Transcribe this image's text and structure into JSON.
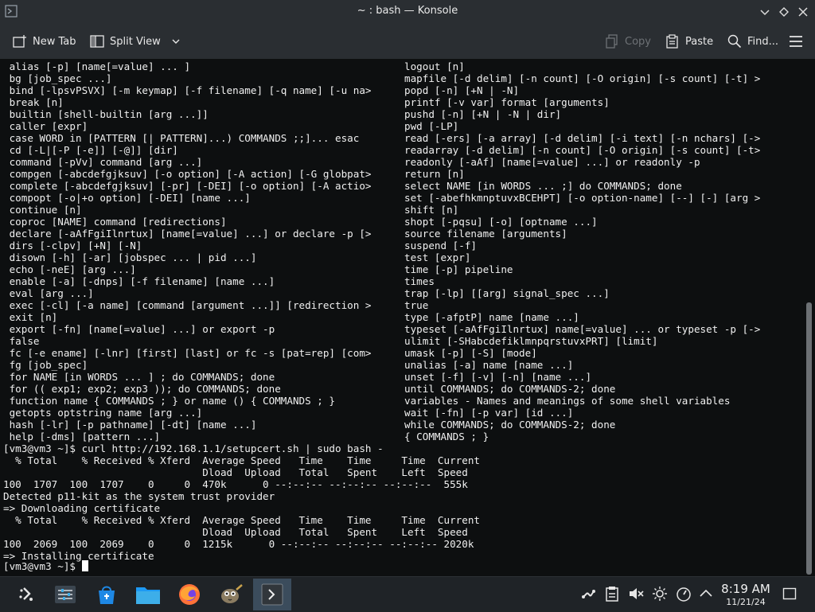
{
  "window": {
    "title": "~ : bash — Konsole"
  },
  "toolbar": {
    "new_tab": "New Tab",
    "split_view": "Split View",
    "copy": "Copy",
    "paste": "Paste",
    "find": "Find..."
  },
  "terminal": {
    "help_left": [
      " alias [-p] [name[=value] ... ]",
      " bg [job_spec ...]",
      " bind [-lpsvPSVX] [-m keymap] [-f filename] [-q name] [-u na>",
      " break [n]",
      " builtin [shell-builtin [arg ...]]",
      " caller [expr]",
      " case WORD in [PATTERN [| PATTERN]...) COMMANDS ;;]... esac",
      " cd [-L|[-P [-e]] [-@]] [dir]",
      " command [-pVv] command [arg ...]",
      " compgen [-abcdefgjksuv] [-o option] [-A action] [-G globpat>",
      " complete [-abcdefgjksuv] [-pr] [-DEI] [-o option] [-A actio>",
      " compopt [-o|+o option] [-DEI] [name ...]",
      " continue [n]",
      " coproc [NAME] command [redirections]",
      " declare [-aAfFgiIlnrtux] [name[=value] ...] or declare -p [>",
      " dirs [-clpv] [+N] [-N]",
      " disown [-h] [-ar] [jobspec ... | pid ...]",
      " echo [-neE] [arg ...]",
      " enable [-a] [-dnps] [-f filename] [name ...]",
      " eval [arg ...]",
      " exec [-cl] [-a name] [command [argument ...]] [redirection >",
      " exit [n]",
      " export [-fn] [name[=value] ...] or export -p",
      " false",
      " fc [-e ename] [-lnr] [first] [last] or fc -s [pat=rep] [com>",
      " fg [job_spec]",
      " for NAME [in WORDS ... ] ; do COMMANDS; done",
      " for (( exp1; exp2; exp3 )); do COMMANDS; done",
      " function name { COMMANDS ; } or name () { COMMANDS ; }",
      " getopts optstring name [arg ...]",
      " hash [-lr] [-p pathname] [-dt] [name ...]",
      " help [-dms] [pattern ...]"
    ],
    "help_right": [
      "logout [n]",
      "mapfile [-d delim] [-n count] [-O origin] [-s count] [-t] >",
      "popd [-n] [+N | -N]",
      "printf [-v var] format [arguments]",
      "pushd [-n] [+N | -N | dir]",
      "pwd [-LP]",
      "read [-ers] [-a array] [-d delim] [-i text] [-n nchars] [->",
      "readarray [-d delim] [-n count] [-O origin] [-s count] [-t>",
      "readonly [-aAf] [name[=value] ...] or readonly -p",
      "return [n]",
      "select NAME [in WORDS ... ;] do COMMANDS; done",
      "set [-abefhkmnptuvxBCEHPT] [-o option-name] [--] [-] [arg >",
      "shift [n]",
      "shopt [-pqsu] [-o] [optname ...]",
      "source filename [arguments]",
      "suspend [-f]",
      "test [expr]",
      "time [-p] pipeline",
      "times",
      "trap [-lp] [[arg] signal_spec ...]",
      "true",
      "type [-afptP] name [name ...]",
      "typeset [-aAfFgiIlnrtux] name[=value] ... or typeset -p [->",
      "ulimit [-SHabcdefiklmnpqrstuvxPRT] [limit]",
      "umask [-p] [-S] [mode]",
      "unalias [-a] name [name ...]",
      "unset [-f] [-v] [-n] [name ...]",
      "until COMMANDS; do COMMANDS-2; done",
      "variables - Names and meanings of some shell variables",
      "wait [-fn] [-p var] [id ...]",
      "while COMMANDS; do COMMANDS-2; done",
      "{ COMMANDS ; }"
    ],
    "output": [
      "[vm3@vm3 ~]$ curl http://192.168.1.1/setupcert.sh | sudo bash -",
      "  % Total    % Received % Xferd  Average Speed   Time    Time     Time  Current",
      "                                 Dload  Upload   Total   Spent    Left  Speed",
      "100  1707  100  1707    0     0  470k      0 --:--:-- --:--:-- --:--:--  555k",
      "Detected p11-kit as the system trust provider",
      "=> Downloading certificate",
      "  % Total    % Received % Xferd  Average Speed   Time    Time     Time  Current",
      "                                 Dload  Upload   Total   Spent    Left  Speed",
      "100  2069  100  2069    0     0  1215k      0 --:--:-- --:--:-- --:--:-- 2020k",
      "=> Installing certificate"
    ],
    "prompt": "[vm3@vm3 ~]$ "
  },
  "taskbar": {
    "apps": [
      "application-launcher-icon",
      "system-settings-icon",
      "discover-store-icon",
      "file-manager-icon",
      "firefox-icon",
      "gimp-icon",
      "konsole-icon"
    ],
    "tray": [
      "network-icon",
      "clipboard-icon",
      "volume-muted-icon",
      "brightness-icon",
      "speedometer-icon",
      "chevron-up-icon"
    ],
    "clock_time": "8:19 AM",
    "clock_date": "11/21/24"
  }
}
